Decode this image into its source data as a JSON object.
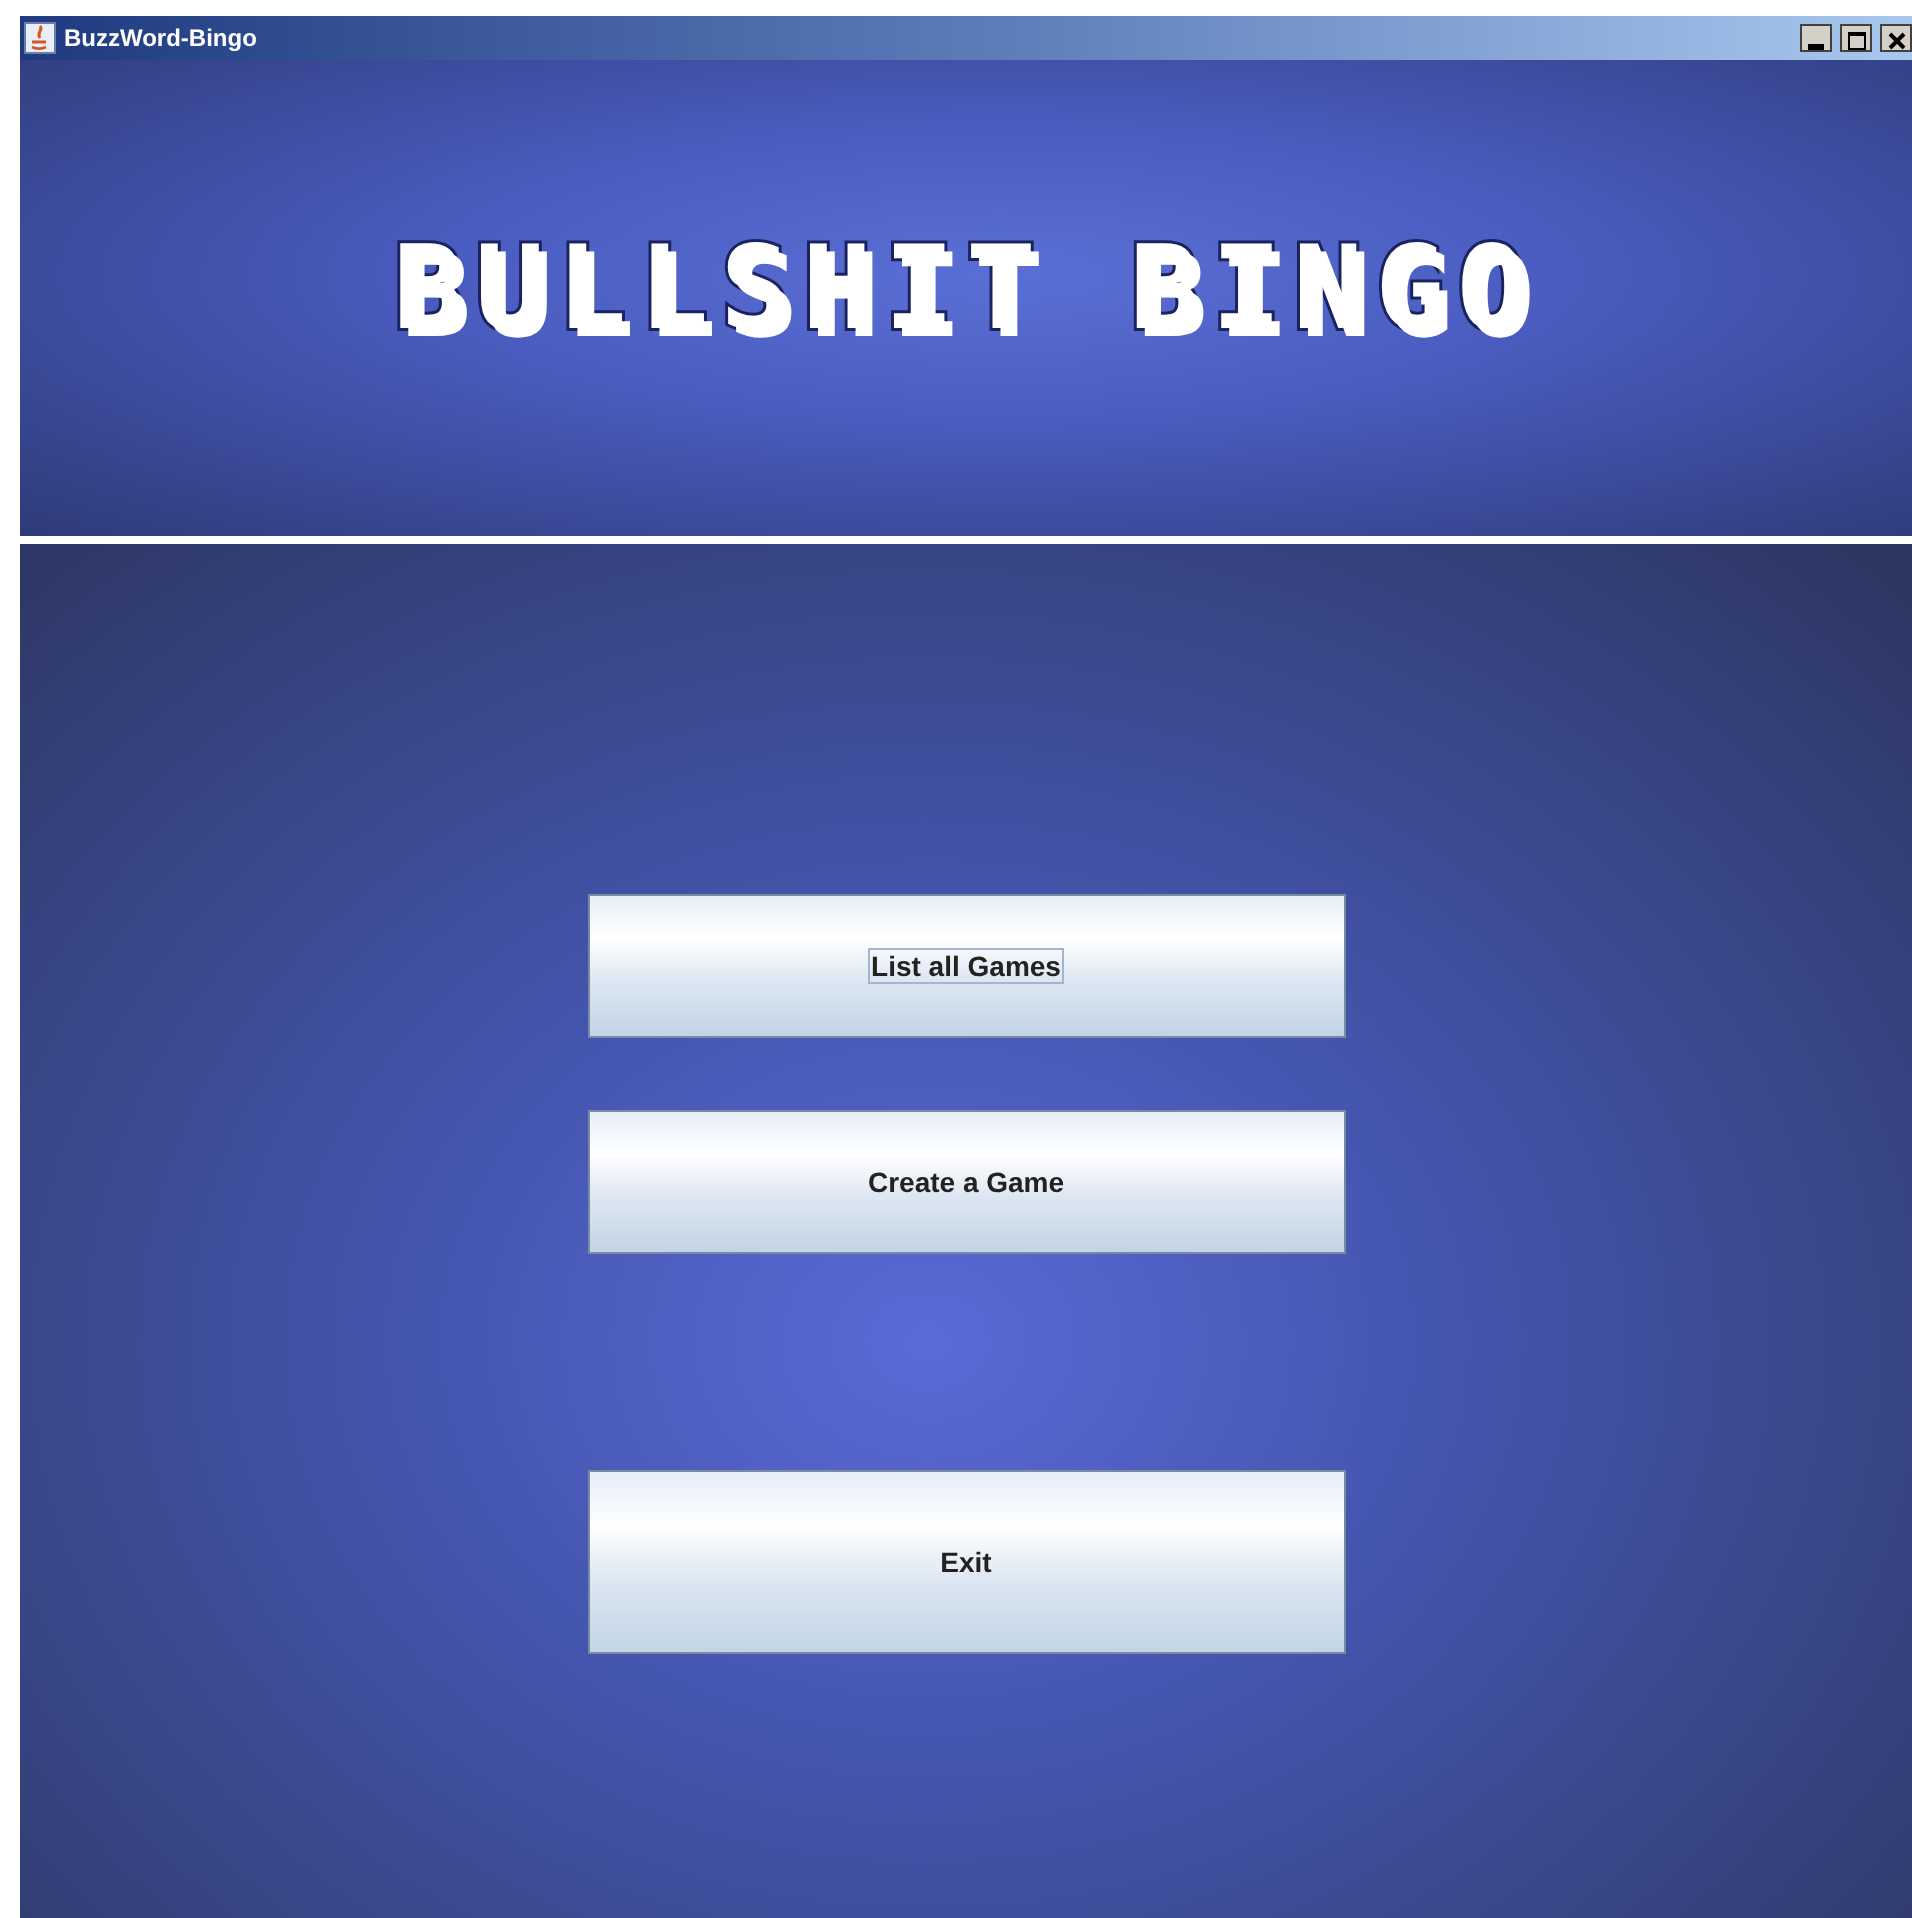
{
  "window": {
    "title": "BuzzWord-Bingo"
  },
  "logo": {
    "text": "BULLSHIT BINGO"
  },
  "buttons": [
    {
      "label": "List all Games",
      "focused": true
    },
    {
      "label": "Create a Game",
      "focused": false
    },
    {
      "label": "Exit",
      "focused": false,
      "kind": "tall"
    }
  ]
}
